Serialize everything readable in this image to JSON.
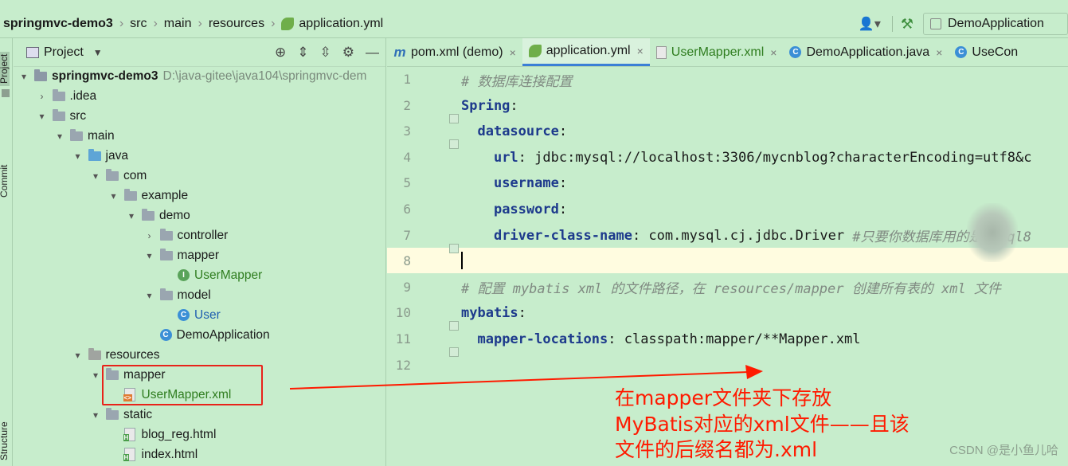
{
  "breadcrumb": [
    "springmvc-demo3",
    "src",
    "main",
    "resources",
    "application.yml"
  ],
  "run_config": "DemoApplication",
  "tool_strip": {
    "project_tab": "Project",
    "commit_tab": "Commit",
    "structure_tab": "Structure"
  },
  "project_panel": {
    "title": "Project",
    "tree": [
      {
        "label": "springmvc-demo3",
        "extra": "D:\\java-gitee\\java104\\springmvc-dem",
        "indent": 0,
        "arrow": "▾",
        "icon": "module",
        "bold": true
      },
      {
        "label": ".idea",
        "indent": 1,
        "arrow": "›",
        "icon": "folder"
      },
      {
        "label": "src",
        "indent": 1,
        "arrow": "▾",
        "icon": "folder"
      },
      {
        "label": "main",
        "indent": 2,
        "arrow": "▾",
        "icon": "folder"
      },
      {
        "label": "java",
        "indent": 3,
        "arrow": "▾",
        "icon": "folder-blue"
      },
      {
        "label": "com",
        "indent": 4,
        "arrow": "▾",
        "icon": "package"
      },
      {
        "label": "example",
        "indent": 5,
        "arrow": "▾",
        "icon": "package"
      },
      {
        "label": "demo",
        "indent": 6,
        "arrow": "▾",
        "icon": "package"
      },
      {
        "label": "controller",
        "indent": 7,
        "arrow": "›",
        "icon": "package"
      },
      {
        "label": "mapper",
        "indent": 7,
        "arrow": "▾",
        "icon": "package"
      },
      {
        "label": "UserMapper",
        "indent": 8,
        "arrow": "",
        "icon": "interface",
        "color": "green"
      },
      {
        "label": "model",
        "indent": 7,
        "arrow": "▾",
        "icon": "package"
      },
      {
        "label": "User",
        "indent": 8,
        "arrow": "",
        "icon": "class",
        "color": "blue"
      },
      {
        "label": "DemoApplication",
        "indent": 7,
        "arrow": "",
        "icon": "class-app"
      },
      {
        "label": "resources",
        "indent": 3,
        "arrow": "▾",
        "icon": "folder-res"
      },
      {
        "label": "mapper",
        "indent": 4,
        "arrow": "▾",
        "icon": "folder"
      },
      {
        "label": "UserMapper.xml",
        "indent": 5,
        "arrow": "",
        "icon": "xml",
        "color": "green"
      },
      {
        "label": "static",
        "indent": 4,
        "arrow": "▾",
        "icon": "folder"
      },
      {
        "label": "blog_reg.html",
        "indent": 5,
        "arrow": "",
        "icon": "html"
      },
      {
        "label": "index.html",
        "indent": 5,
        "arrow": "",
        "icon": "html"
      }
    ]
  },
  "editor": {
    "tabs": [
      {
        "label": "pom.xml (demo)",
        "icon": "m",
        "active": false
      },
      {
        "label": "application.yml",
        "icon": "leaf",
        "active": true
      },
      {
        "label": "UserMapper.xml",
        "icon": "xml",
        "active": false,
        "color": "green"
      },
      {
        "label": "DemoApplication.java",
        "icon": "c",
        "active": false
      },
      {
        "label": "UseCon",
        "icon": "c",
        "active": false
      }
    ],
    "lines": [
      {
        "no": "1",
        "parts": [
          {
            "t": "# 数据库连接配置",
            "c": "cm"
          }
        ]
      },
      {
        "no": "2",
        "parts": [
          {
            "t": "Spring",
            "c": "k"
          },
          {
            "t": ":",
            "c": "v"
          }
        ]
      },
      {
        "no": "3",
        "parts": [
          {
            "t": "  ",
            "c": "v"
          },
          {
            "t": "datasource",
            "c": "k"
          },
          {
            "t": ":",
            "c": "v"
          }
        ]
      },
      {
        "no": "4",
        "parts": [
          {
            "t": "    ",
            "c": "v"
          },
          {
            "t": "url",
            "c": "k"
          },
          {
            "t": ": jdbc:mysql://localhost:3306/mycnblog?characterEncoding=utf8&c",
            "c": "v"
          }
        ]
      },
      {
        "no": "5",
        "parts": [
          {
            "t": "    ",
            "c": "v"
          },
          {
            "t": "username",
            "c": "k"
          },
          {
            "t": ":",
            "c": "v"
          }
        ]
      },
      {
        "no": "6",
        "parts": [
          {
            "t": "    ",
            "c": "v"
          },
          {
            "t": "password",
            "c": "k"
          },
          {
            "t": ":",
            "c": "v"
          }
        ]
      },
      {
        "no": "7",
        "parts": [
          {
            "t": "    ",
            "c": "v"
          },
          {
            "t": "driver-class-name",
            "c": "k"
          },
          {
            "t": ": com.mysql.cj.jdbc.Driver ",
            "c": "v"
          },
          {
            "t": "#只要你数据库用的是mysql8",
            "c": "cm"
          }
        ]
      },
      {
        "no": "8",
        "parts": []
      },
      {
        "no": "9",
        "parts": [
          {
            "t": "# 配置 mybatis xml 的文件路径，在 resources/mapper 创建所有表的 xml 文件",
            "c": "cm"
          }
        ]
      },
      {
        "no": "10",
        "parts": [
          {
            "t": "mybatis",
            "c": "k"
          },
          {
            "t": ":",
            "c": "v"
          }
        ]
      },
      {
        "no": "11",
        "parts": [
          {
            "t": "  ",
            "c": "v"
          },
          {
            "t": "mapper-locations",
            "c": "k"
          },
          {
            "t": ": classpath:mapper/**Mapper.xml",
            "c": "v"
          }
        ]
      },
      {
        "no": "12",
        "parts": []
      }
    ]
  },
  "annotation": {
    "lines": [
      "在mapper文件夹下存放",
      "MyBatis对应的xml文件——且该",
      "文件的后缀名都为.xml"
    ],
    "color": "#ff1a00"
  },
  "watermark": "CSDN @是小鱼儿哈"
}
